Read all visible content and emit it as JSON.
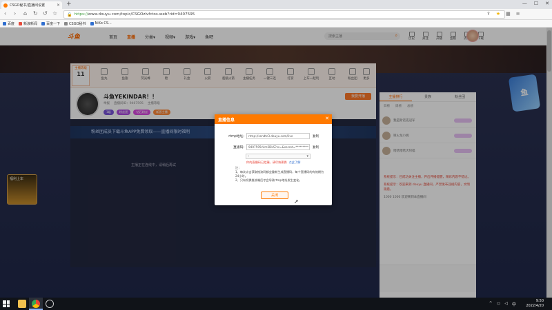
{
  "browser": {
    "tab_title": "CSGO秘书/直播间设置",
    "new_tab": "+",
    "url_scheme": "https://",
    "url": "www.douyu.com/topic/CSGOzlvfctos-web?rid=9407595",
    "bookmarks": [
      "百度",
      "新浪新闻",
      "百度一下",
      "CSGO秘书",
      "NiKo CS..."
    ],
    "win_min": "—",
    "win_max": "☐",
    "win_close": "✕"
  },
  "site": {
    "logo": "斗鱼",
    "nav": [
      "首页",
      "直播",
      "分类▾",
      "视频▾",
      "游戏▾",
      "鱼吧"
    ],
    "search_placeholder": "搜索主播",
    "user_icons": [
      "历史",
      "关注",
      "开播",
      "鱼粮",
      "消息",
      "下载"
    ]
  },
  "room": {
    "rank_label": "主播等级",
    "rank_value": "11",
    "gifts": [
      "鱼丸",
      "鱼翅",
      "荧光棒",
      "稳",
      "礼盒",
      "火箭",
      "超级火箭",
      "主播任务",
      "一键三连",
      "打赏",
      "上车一起玩",
      "互动",
      "粉丝团",
      "更多"
    ],
    "title": "斗鱼YEKINDAR！！",
    "meta": [
      "举报",
      "直播间ID：9407595",
      "主播等级"
    ],
    "tags": [
      "1级",
      "粉丝团",
      "钻石粉丝",
      "新晋主播"
    ],
    "report_label": "我要开播",
    "banner": "粉丝团成员下载斗鱼APP免费领取——直播间限时福利",
    "video_msg": "主播正在连线中，请稍后再试",
    "card_label": "福利上车"
  },
  "sidebar": {
    "tabs": [
      "主播排行",
      "贵族",
      "粉丝团"
    ],
    "sub": [
      "日榜",
      "周榜",
      "总榜"
    ],
    "items": [
      "我是斯诺克冠军",
      "喷火龙小桃",
      "哈哈哈哈大阿福"
    ],
    "chat": [
      {
        "type": "sys",
        "text": "系统提示：已成功关注主播，开启开播提醒，精彩内容不错过。"
      },
      {
        "type": "sys",
        "text": "系统提示：欢迎来到 douyu 直播间，严禁发布违规内容，文明观看。"
      },
      {
        "type": "user",
        "text": "1000 1000 欢迎来到本直播间"
      }
    ]
  },
  "modal": {
    "title": "直播信息",
    "close": "✕",
    "rtmp_label": "rtmp地址:",
    "rtmp_value": "rtmp://sendtc3.douyu.com/live",
    "code_label": "直播码:",
    "code_value": "9407595rUm5DkS?ss=&secret=*********",
    "copy": "复制",
    "select_value": "•",
    "warn": "你的直播码已泄漏，请尽快更换",
    "more": "点此了解",
    "notes_title": "注：",
    "notes": [
      "1、每次点击获取推流码都会重新生成直播码，每个直播码的有效期为24小时。",
      "2、只有切换推流端后才会导致rtmp地址发生变化。"
    ],
    "ok": "关闭"
  },
  "taskbar": {
    "time": "9:50",
    "date": "2022/4/20"
  }
}
